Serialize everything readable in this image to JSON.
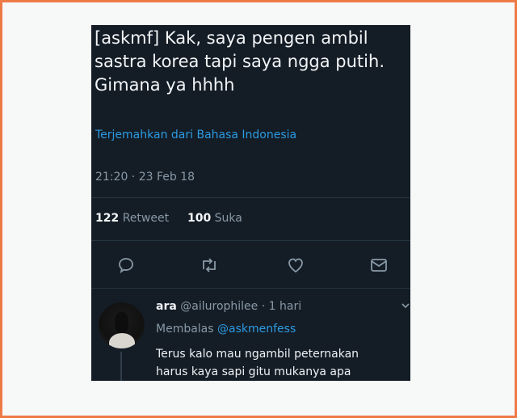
{
  "tweet": {
    "text": "[askmf] Kak, saya pengen ambil\nsastra korea tapi saya ngga putih.\nGimana ya hhhh",
    "translate_link": "Terjemahkan dari Bahasa Indonesia",
    "timestamp": "21:20 · 23 Feb 18",
    "retweet_count": "122",
    "retweet_label": "Retweet",
    "like_count": "100",
    "like_label": "Suka",
    "actions": [
      "reply-icon",
      "retweet-icon",
      "like-icon",
      "message-icon"
    ]
  },
  "reply": {
    "name": "ara",
    "handle": "@ailurophilee",
    "time": "· 1 hari",
    "replying_label": "Membalas",
    "replying_to": "@askmenfess",
    "text": "Terus kalo mau ngambil peternakan\nharus kaya sapi gitu mukanya apa"
  },
  "colors": {
    "background": "#141d26",
    "accent": "#2c9ae2",
    "muted": "#8899a6",
    "frame_border": "#ee7a46"
  }
}
